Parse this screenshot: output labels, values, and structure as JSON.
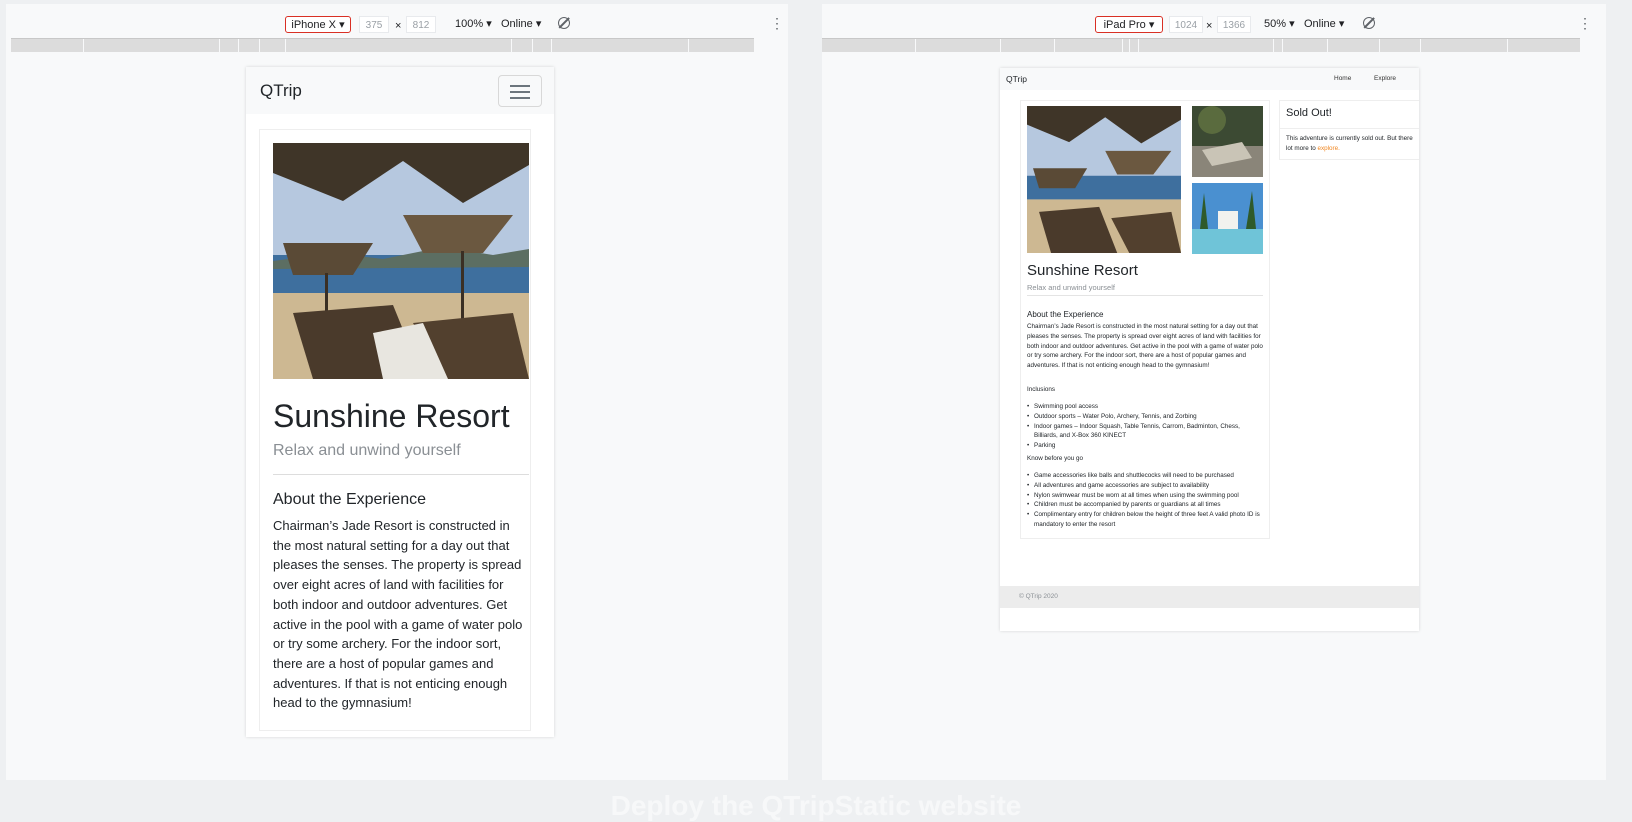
{
  "caption": "Deploy the QTripStatic website",
  "left_devtools": {
    "device": "iPhone X ▾",
    "width": "375",
    "times": "×",
    "height": "812",
    "zoom": "100% ▾",
    "network": "Online ▾",
    "more": "⋮"
  },
  "right_devtools": {
    "device": "iPad Pro ▾",
    "width": "1024",
    "times": "×",
    "height": "1366",
    "zoom": "50% ▾",
    "network": "Online ▾",
    "more": "⋮"
  },
  "site": {
    "brand": "QTrip",
    "nav_home": "Home",
    "nav_explore": "Explore",
    "title": "Sunshine Resort",
    "subtitle": "Relax and unwind yourself",
    "about_heading": "About the Experience",
    "about_text": "Chairman’s Jade Resort is constructed in the most natural setting for a day out that pleases the senses. The property is spread over eight acres of land with facilities for both indoor and outdoor adventures. Get active in the pool with a game of water polo or try some archery. For the indoor sort, there are a host of popular games and adventures. If that is not enticing enough head to the gymnasium!",
    "inclusions_heading": "Inclusions",
    "inclusions": [
      "Swimming pool access",
      "Outdoor sports – Water Polo, Archery, Tennis, and Zorbing",
      "Indoor games – Indoor Squash, Table Tennis, Carrom, Badminton, Chess, Billiards, and X-Box 360 KINECT",
      "Parking"
    ],
    "know_heading": "Know before you go",
    "know": [
      "Game accessories like balls and shuttlecocks will need to be purchased",
      "All adventures and game accessories are subject to availability",
      "Nylon swimwear must be worn at all times when using the swimming pool",
      "Children must be accompanied by parents or guardians at all times",
      "Complimentary entry for children below the height of three feet A valid photo ID is mandatory to enter the resort"
    ],
    "sold_out_title": "Sold Out!",
    "sold_out_text": "This adventure is currently sold out. But there",
    "sold_out_text2": "lot more to",
    "sold_out_link": "explore.",
    "footer": "© QTrip 2020"
  },
  "colors": {
    "link": "#f0851f",
    "device_border": "#d93025"
  }
}
